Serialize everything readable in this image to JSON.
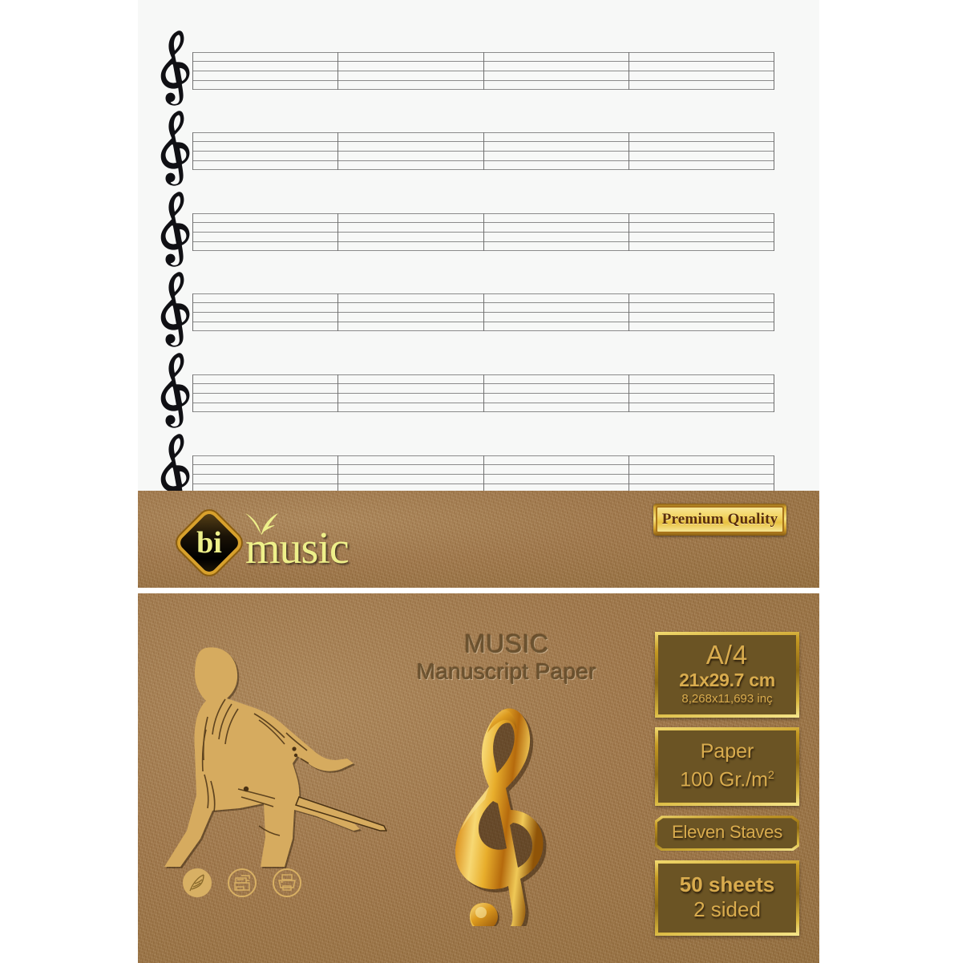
{
  "product": {
    "brand_name": "bi",
    "brand_word": "music",
    "brand_icon": "swallow-bird-icon",
    "badge_label": "Premium Quality",
    "title_line1": "MUSIC",
    "title_line2": "Manuscript Paper"
  },
  "specs": [
    {
      "id": "size",
      "size_label": "A/4",
      "dimensions_cm": "21x29.7 cm",
      "dimensions_in": "8,268x11,693 inç"
    },
    {
      "id": "paper",
      "paper_label": "Paper",
      "weight_label": "100 Gr./m",
      "weight_sup": "2"
    },
    {
      "id": "staves",
      "staves_label": "Eleven Staves"
    },
    {
      "id": "sheets",
      "sheets_label": "50 sheets",
      "sided_label": "2 sided"
    }
  ],
  "icons": [
    {
      "name": "quill-pen-icon",
      "style": "filled"
    },
    {
      "name": "photocopier-icon",
      "style": "outline"
    },
    {
      "name": "printer-icon",
      "style": "outline"
    }
  ],
  "artwork": {
    "conductor": "conductor-silhouette",
    "treble_clef": "golden-treble-clef"
  },
  "sheet": {
    "staff_count_visible": 6,
    "lines_per_staff": 5,
    "measures_per_staff": 4,
    "clef_symbol": "treble-clef"
  },
  "colors": {
    "kraft": "#a37a4c",
    "gold": "#d9ac4e",
    "gold_bright": "#f3dc72",
    "box_face": "#6b5424",
    "paper": "#f7f8f7",
    "staff_line": "#8b8b8b",
    "title_brown": "#6b5331",
    "logo_yellow": "#eef08a",
    "badge_text": "#5a2e0b"
  }
}
